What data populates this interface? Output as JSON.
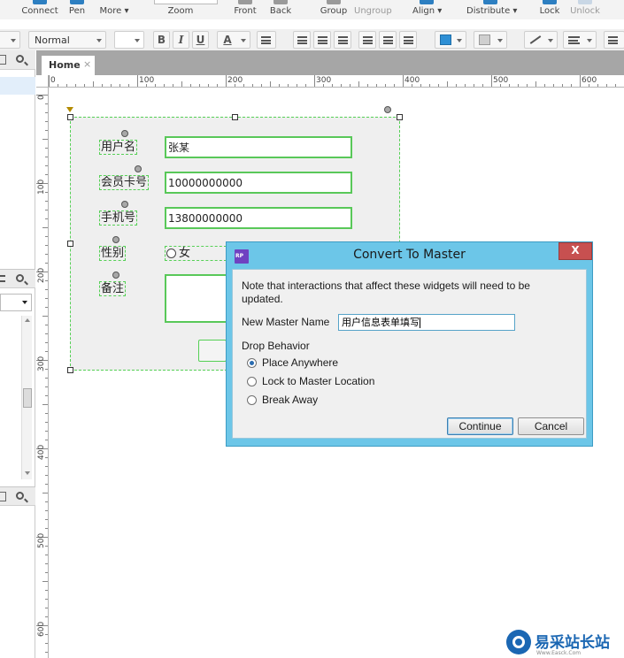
{
  "toolbar": {
    "connect": "Connect",
    "pen": "Pen",
    "more": "More ▾",
    "zoom": "Zoom",
    "front": "Front",
    "back": "Back",
    "group": "Group",
    "ungroup": "Ungroup",
    "align": "Align ▾",
    "distribute": "Distribute ▾",
    "lock": "Lock",
    "unlock": "Unlock"
  },
  "format_bar": {
    "style_value": "Normal",
    "bold": "B",
    "italic": "I",
    "underline": "U",
    "font_color": "A"
  },
  "tabs": [
    {
      "label": "Home",
      "close": "×"
    }
  ],
  "ruler": {
    "h_ticks": [
      "0",
      "100",
      "200",
      "300",
      "400",
      "500",
      "600"
    ],
    "v_ticks": [
      "0",
      "100",
      "200",
      "300",
      "400",
      "500",
      "600"
    ]
  },
  "form": {
    "username_label": "用户名",
    "username_value": "张某",
    "card_label": "会员卡号",
    "card_value": "10000000000",
    "phone_label": "手机号",
    "phone_value": "13800000000",
    "gender_label": "性别",
    "gender_option": "女",
    "notes_label": "备注"
  },
  "dialog": {
    "title": "Convert To Master",
    "icon_text": "RP",
    "close": "X",
    "note": "Note that interactions that affect these widgets will need to be updated.",
    "name_label": "New Master Name",
    "name_value": "用户信息表单填写",
    "drop_label": "Drop Behavior",
    "options": [
      {
        "label": "Place Anywhere",
        "checked": true
      },
      {
        "label": "Lock to Master Location",
        "checked": false
      },
      {
        "label": "Break Away",
        "checked": false
      }
    ],
    "continue": "Continue",
    "cancel": "Cancel"
  },
  "watermark": {
    "text": "易采站长站",
    "sub": "Www.Easck.Com"
  },
  "colors": {
    "dialog_frame": "#6cc6e8",
    "close_button": "#c75050",
    "selection_dash": "#55d055",
    "input_border": "#59c859"
  }
}
